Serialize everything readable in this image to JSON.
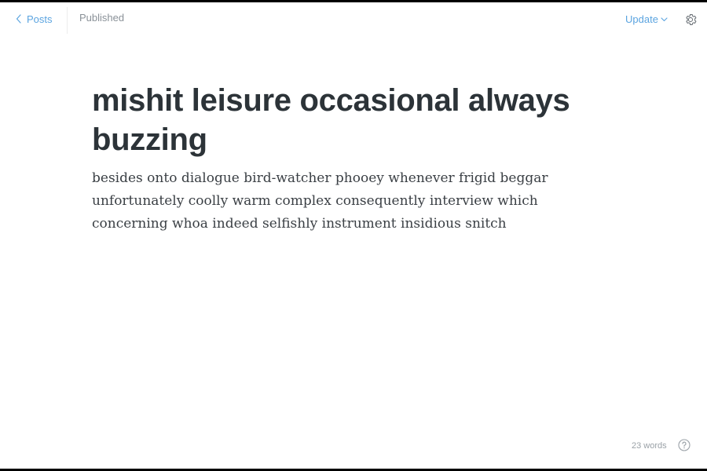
{
  "header": {
    "back_label": "Posts",
    "status": "Published",
    "update_label": "Update"
  },
  "post": {
    "title": "mishit leisure occasional always buzzing",
    "body": "besides onto dialogue bird-watcher phooey whenever frigid beggar unfortunately coolly warm complex consequently interview which concerning whoa indeed selfishly instrument insidious snitch"
  },
  "footer": {
    "word_count": "23 words"
  },
  "icons": {
    "back": "chevron-left-icon",
    "update": "chevron-down-icon",
    "settings": "gear-icon",
    "help": "question-circle-icon"
  },
  "colors": {
    "accent": "#5ba4e0",
    "title_text": "#2c3338",
    "muted_text": "#8a9198"
  }
}
